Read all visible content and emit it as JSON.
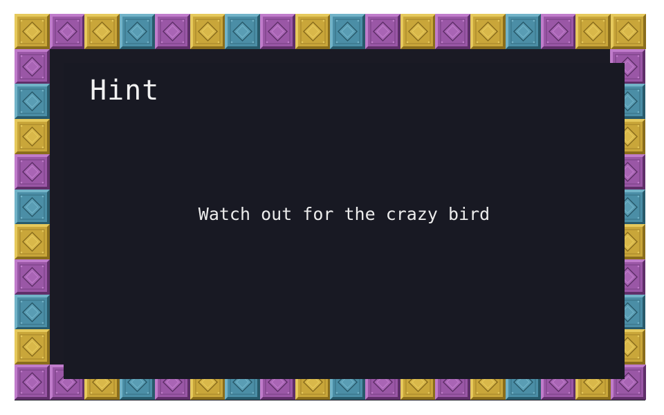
{
  "dialog": {
    "title": "Hint",
    "message": "Watch out for the crazy bird"
  },
  "border": {
    "tile_icon": "diamond-gem-tile",
    "palette": {
      "gold": {
        "face": "#c9a63a",
        "light": "#e6c95c",
        "dark": "#8a6d1c",
        "gem": "#d9b84a"
      },
      "purple": {
        "face": "#9a57a6",
        "light": "#c07ccb",
        "dark": "#5f2f69",
        "gem": "#a965b5"
      },
      "blue": {
        "face": "#4b8ea6",
        "light": "#72b3c8",
        "dark": "#285a6b",
        "gem": "#5a9db4"
      }
    },
    "top_row": [
      "gold",
      "purple",
      "gold",
      "blue",
      "purple",
      "gold",
      "blue",
      "purple",
      "gold",
      "blue",
      "purple",
      "gold",
      "purple",
      "gold",
      "blue",
      "purple",
      "gold",
      "gold"
    ],
    "bottom_row": [
      "purple",
      "purple",
      "gold",
      "blue",
      "purple",
      "gold",
      "blue",
      "purple",
      "gold",
      "blue",
      "purple",
      "gold",
      "purple",
      "gold",
      "blue",
      "purple",
      "gold",
      "purple"
    ],
    "left_column": [
      "purple",
      "blue",
      "gold",
      "purple",
      "blue",
      "gold",
      "purple",
      "blue",
      "gold"
    ],
    "right_column": [
      "purple",
      "blue",
      "gold",
      "purple",
      "blue",
      "gold",
      "purple",
      "blue",
      "gold"
    ]
  }
}
